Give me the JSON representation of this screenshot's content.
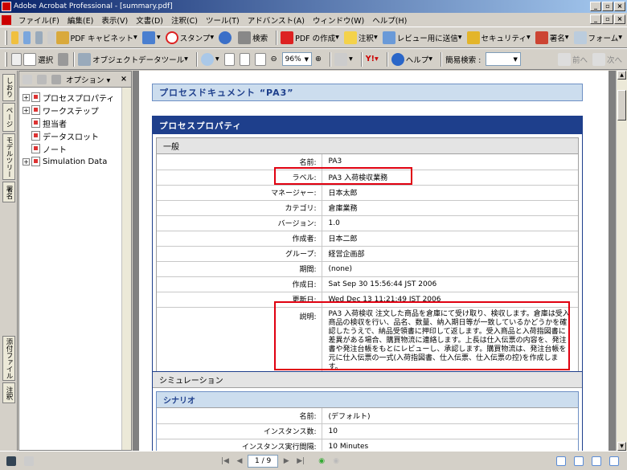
{
  "window": {
    "title": "Adobe Acrobat Professional - [summary.pdf]"
  },
  "menu": [
    "ファイル(F)",
    "編集(E)",
    "表示(V)",
    "文書(D)",
    "注釈(C)",
    "ツール(T)",
    "アドバンスト(A)",
    "ウィンドウ(W)",
    "ヘルプ(H)"
  ],
  "toolbar1": {
    "pdf_cabinet": "PDF キャビネット",
    "stamp": "スタンプ",
    "search": "検索",
    "create_pdf": "PDF の作成",
    "comment": "注釈",
    "send_review": "レビュー用に送信",
    "security": "セキュリティ",
    "sign": "署名",
    "form": "フォーム"
  },
  "toolbar2": {
    "select": "選択",
    "object_data": "オブジェクトデータツール",
    "zoom": "96%",
    "help": "ヘルプ",
    "quick_search": "簡易検索 :",
    "prev": "前へ",
    "next": "次へ"
  },
  "navtabs": [
    "しおり",
    "ページ",
    "モデルツリー",
    "署名",
    "添付ファイル",
    "注釈"
  ],
  "panel": {
    "options": "オプション",
    "items": [
      {
        "label": "プロセスプロパティ",
        "expander": "+"
      },
      {
        "label": "ワークステップ",
        "expander": "+"
      },
      {
        "label": "担当者",
        "expander": ""
      },
      {
        "label": "データスロット",
        "expander": ""
      },
      {
        "label": "ノート",
        "expander": ""
      },
      {
        "label": "Simulation Data",
        "expander": "+"
      }
    ]
  },
  "document": {
    "title": "プロセスドキュメント “PA3”",
    "section_title": "プロセスプロパティ",
    "general_title": "一般",
    "properties": [
      {
        "key": "名前:",
        "value": "PA3"
      },
      {
        "key": "ラベル:",
        "value": "PA3 入荷検収業務"
      },
      {
        "key": "マネージャー:",
        "value": "日本太郎"
      },
      {
        "key": "カテゴリ:",
        "value": "倉庫業務"
      },
      {
        "key": "バージョン:",
        "value": "1.0"
      },
      {
        "key": "作成者:",
        "value": "日本二郎"
      },
      {
        "key": "グループ:",
        "value": "経営企画部"
      },
      {
        "key": "期間:",
        "value": "(none)"
      },
      {
        "key": "作成日:",
        "value": "Sat Sep 30 15:56:44 JST 2006"
      },
      {
        "key": "更新日:",
        "value": "Wed Dec 13 11:21:49 JST 2006"
      }
    ],
    "description_key": "説明:",
    "description": "PA3 入荷検収 注文した商品を倉庫にて受け取り、検収します。倉庫は受入商品の検収を行い、品名、数量、納入期日等が一致しているかどうかを確認したうえで、納品受領書に押印して返します。受入商品と入荷指図書に差異がある場合、購買物流に連絡します。上長は仕入伝票の内容を、発注書や発注台帳をもとにレビューし、承認します。購買物流は、発注台帳を元に仕入伝票の一式(入荷指図書、仕入伝票、仕入伝票の控)を作成します。",
    "simulation_title": "シミュレーション",
    "scenario_title": "シナリオ",
    "scenario": [
      {
        "key": "名前:",
        "value": "(デフォルト)"
      },
      {
        "key": "インスタンス数:",
        "value": "10"
      },
      {
        "key": "インスタンス実行間隔:",
        "value": "10 Minutes"
      }
    ]
  },
  "statusbar": {
    "page": "1 / 9"
  }
}
